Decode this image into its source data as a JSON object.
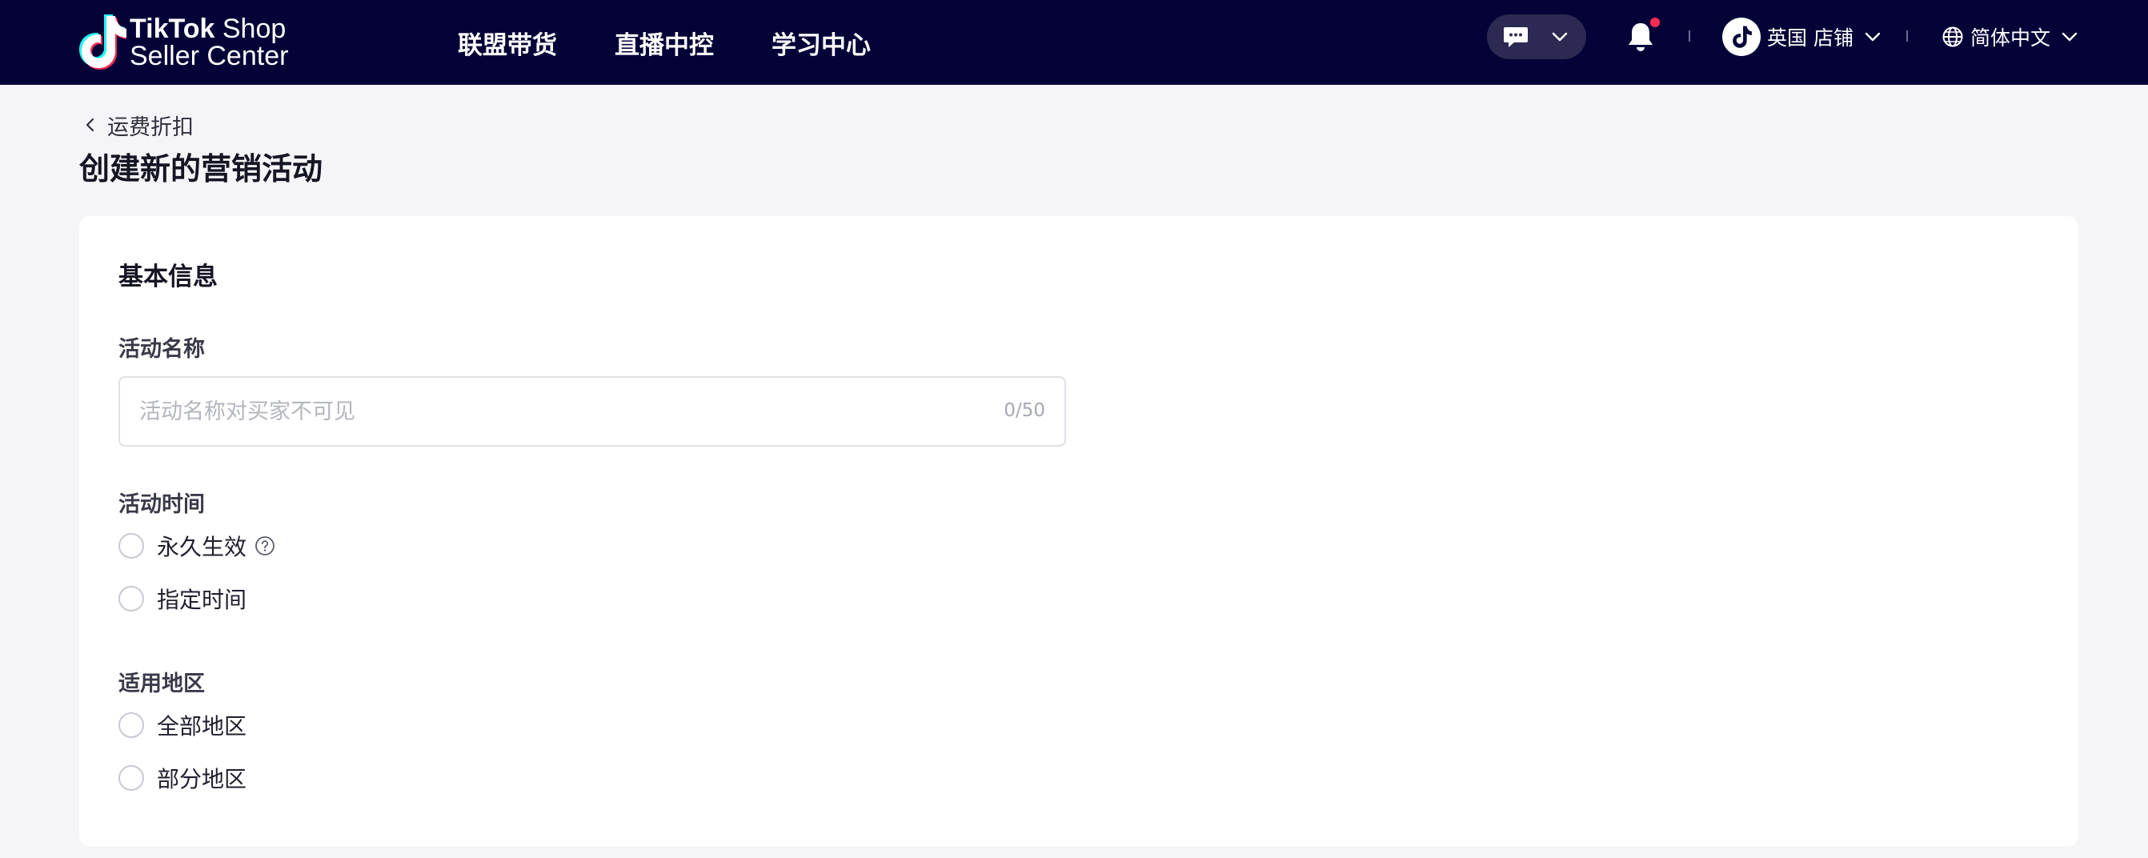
{
  "topbar": {
    "logo": {
      "line1_bold": "TikTok",
      "line1_rest": " Shop",
      "line2": "Seller Center"
    },
    "nav": [
      "联盟带货",
      "直播中控",
      "学习中心"
    ],
    "store": {
      "label": "英国 店铺"
    },
    "language": {
      "label": "简体中文"
    },
    "colors": {
      "background": "#050238",
      "notification_dot": "#fe2c55"
    }
  },
  "header": {
    "back_label": "运费折扣",
    "title": "创建新的营销活动"
  },
  "form": {
    "section_title": "基本信息",
    "name": {
      "label": "活动名称",
      "placeholder": "活动名称对买家不可见",
      "value": "",
      "counter": "0/50"
    },
    "time": {
      "label": "活动时间",
      "options": [
        "永久生效",
        "指定时间"
      ]
    },
    "region": {
      "label": "适用地区",
      "options": [
        "全部地区",
        "部分地区"
      ]
    }
  }
}
